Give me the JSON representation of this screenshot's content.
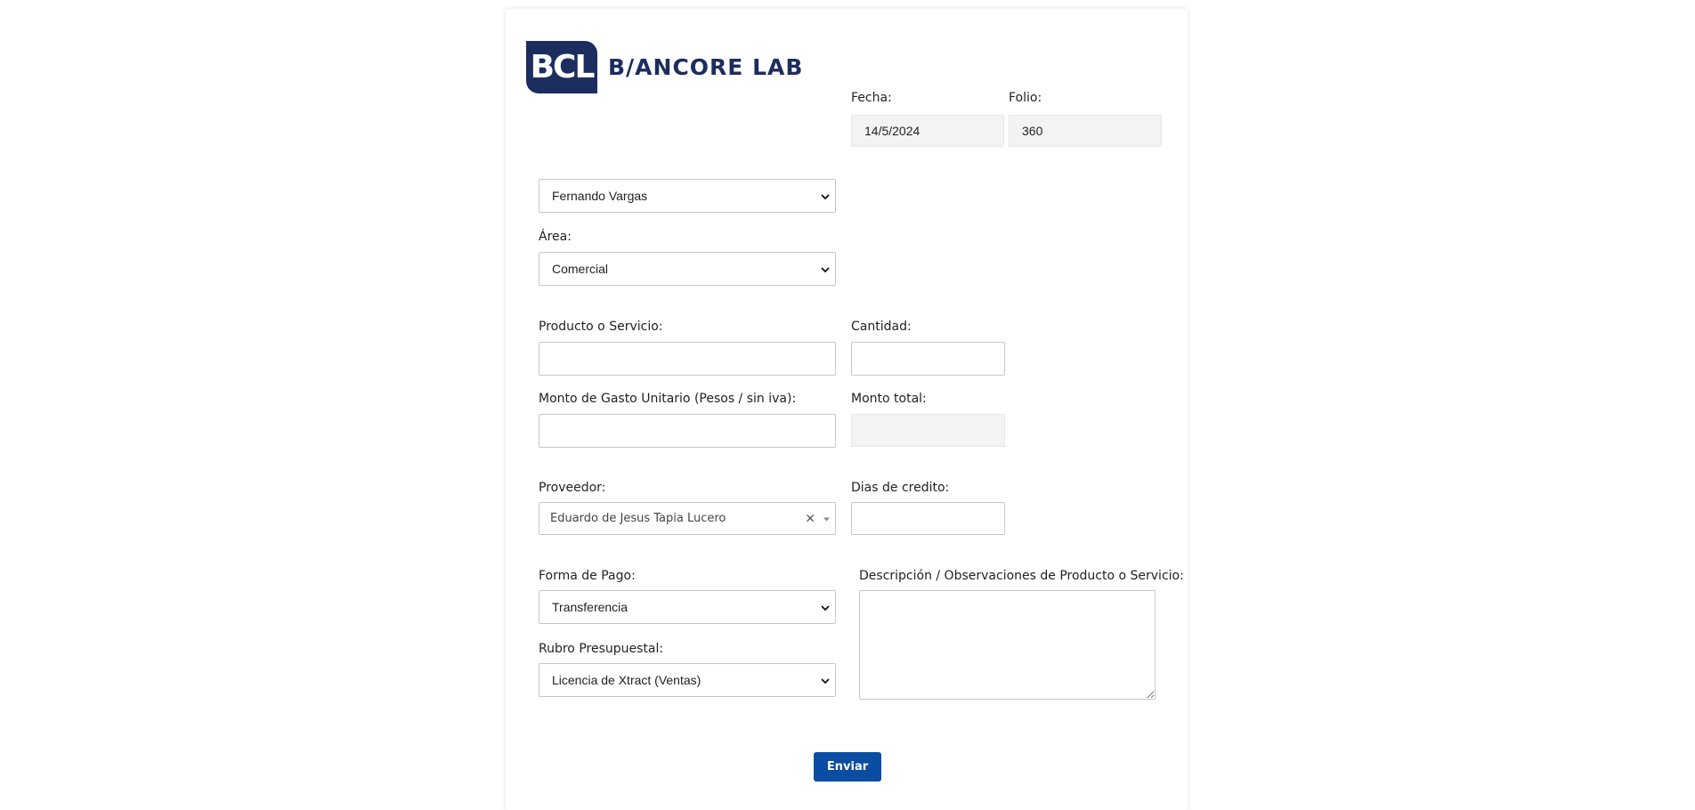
{
  "brand": {
    "badge": "BCL",
    "name": "B/ANCORE LAB"
  },
  "header": {
    "fecha_label": "Fecha:",
    "fecha_value": "14/5/2024",
    "folio_label": "Folio:",
    "folio_value": "360"
  },
  "form": {
    "solicitante": "Fernando Vargas",
    "area_label": "Área:",
    "area_value": "Comercial",
    "producto_label": "Producto o Servicio:",
    "producto_value": "",
    "cantidad_label": "Cantidad:",
    "cantidad_value": "",
    "monto_unitario_label": "Monto de Gasto Unitario (Pesos / sin iva):",
    "monto_unitario_value": "",
    "monto_total_label": "Monto total:",
    "monto_total_value": "",
    "proveedor_label": "Proveedor:",
    "proveedor_value": "Eduardo de Jesus Tapia Lucero",
    "proveedor_clear": "×",
    "dias_label": "Dias de credito:",
    "dias_value": "",
    "forma_pago_label": "Forma de Pago:",
    "forma_pago_value": "Transferencia",
    "rubro_label": "Rubro Presupuestal:",
    "rubro_value": "Licencia de Xtract (Ventas)",
    "descripcion_label": "Descripción / Observaciones de Producto o Servicio:",
    "descripcion_value": "",
    "submit_label": "Enviar"
  },
  "icons": {
    "select_chevron": "chevron-down-icon",
    "caret": "caret-down-icon",
    "clear": "clear-icon"
  },
  "colors": {
    "brand": "#1c2d5f",
    "button": "#0b4da2"
  }
}
